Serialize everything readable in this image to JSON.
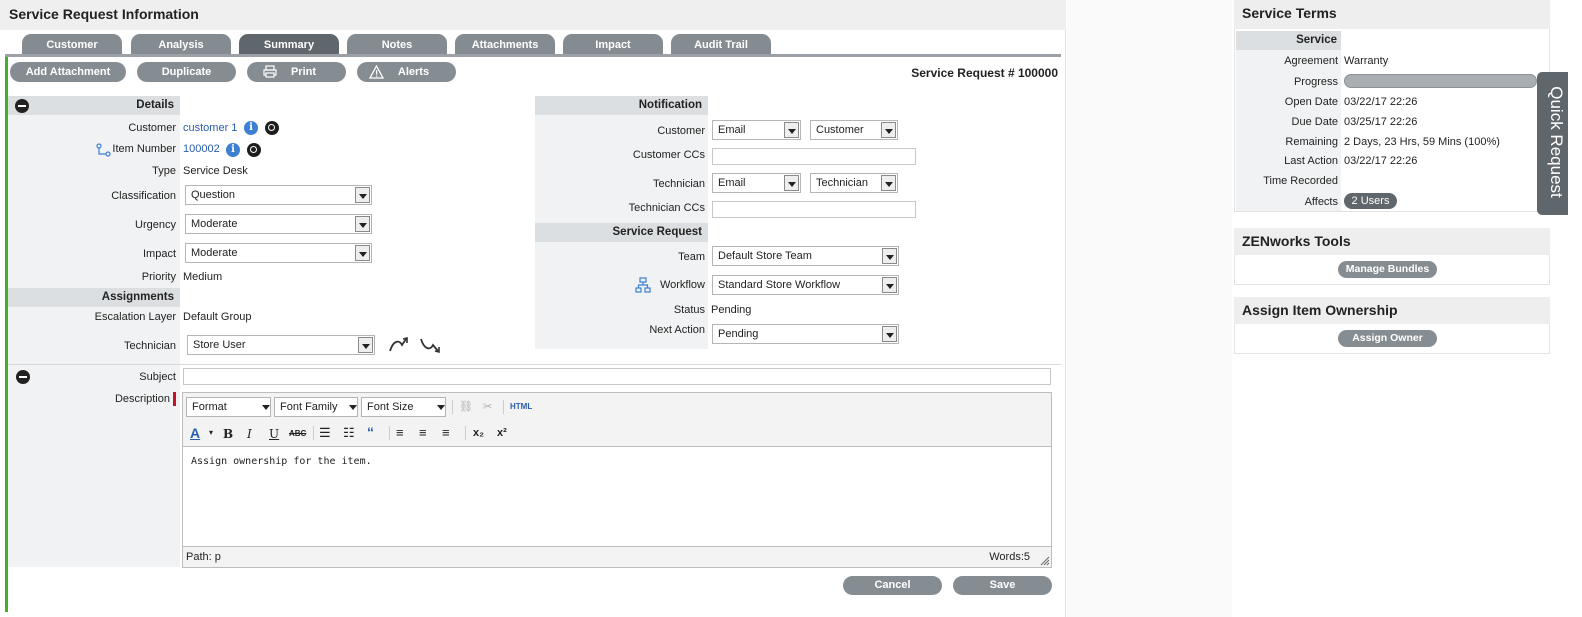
{
  "header": {
    "title": "Service Request Information"
  },
  "tabs": [
    "Customer",
    "Analysis",
    "Summary",
    "Notes",
    "Attachments",
    "Impact",
    "Audit Trail"
  ],
  "toolbar": {
    "add_attachment": "Add Attachment",
    "duplicate": "Duplicate",
    "print": "Print",
    "alerts": "Alerts",
    "request_number": "Service Request # 100000"
  },
  "details": {
    "section": "Details",
    "customer_label": "Customer",
    "customer_value": "customer 1",
    "item_label": "Item Number",
    "item_value": "100002",
    "type_label": "Type",
    "type_value": "Service Desk",
    "classification_label": "Classification",
    "classification_value": "Question",
    "urgency_label": "Urgency",
    "urgency_value": "Moderate",
    "impact_label": "Impact",
    "impact_value": "Moderate",
    "priority_label": "Priority",
    "priority_value": "Medium"
  },
  "assignments": {
    "section": "Assignments",
    "escalation_label": "Escalation Layer",
    "escalation_value": "Default Group",
    "technician_label": "Technician",
    "technician_value": "Store User"
  },
  "notification": {
    "section": "Notification",
    "customer_label": "Customer",
    "customer_method": "Email",
    "customer_target": "Customer",
    "customer_ccs_label": "Customer CCs",
    "technician_label": "Technician",
    "technician_method": "Email",
    "technician_target": "Technician",
    "technician_ccs_label": "Technician CCs"
  },
  "service_request": {
    "section": "Service Request",
    "team_label": "Team",
    "team_value": "Default Store Team",
    "workflow_label": "Workflow",
    "workflow_value": "Standard Store Workflow",
    "status_label": "Status",
    "status_value": "Pending",
    "next_action_label": "Next Action",
    "next_action_value": "Pending"
  },
  "subject": {
    "label": "Subject",
    "value": ""
  },
  "description": {
    "label": "Description",
    "format": "Format",
    "font_family": "Font Family",
    "font_size": "Font Size",
    "html": "HTML",
    "content": "Assign ownership for the item.",
    "path": "Path: p",
    "words": "Words:5"
  },
  "footer": {
    "cancel": "Cancel",
    "save": "Save"
  },
  "service_terms": {
    "title": "Service Terms",
    "service_label": "Service",
    "agreement_label": "Agreement",
    "agreement_value": "Warranty",
    "progress_label": "Progress",
    "progress_fraction": 0.0,
    "open_label": "Open Date",
    "open_value": "03/22/17 22:26",
    "due_label": "Due Date",
    "due_value": "03/25/17 22:26",
    "remaining_label": "Remaining",
    "remaining_value": "2 Days, 23 Hrs, 59 Mins (100%)",
    "last_action_label": "Last Action",
    "last_action_value": "03/22/17 22:26",
    "time_recorded_label": "Time Recorded",
    "affects_label": "Affects",
    "affects_value": "2 Users"
  },
  "zenworks": {
    "title": "ZENworks Tools",
    "button": "Manage Bundles"
  },
  "ownership": {
    "title": "Assign Item Ownership",
    "button": "Assign Owner"
  },
  "quick_request": {
    "label": "Quick Request"
  },
  "colors": {
    "accent_green": "#43b02a",
    "tab_gray": "#858c91",
    "active_tab": "#5f676c",
    "link_blue": "#2a5db0"
  }
}
